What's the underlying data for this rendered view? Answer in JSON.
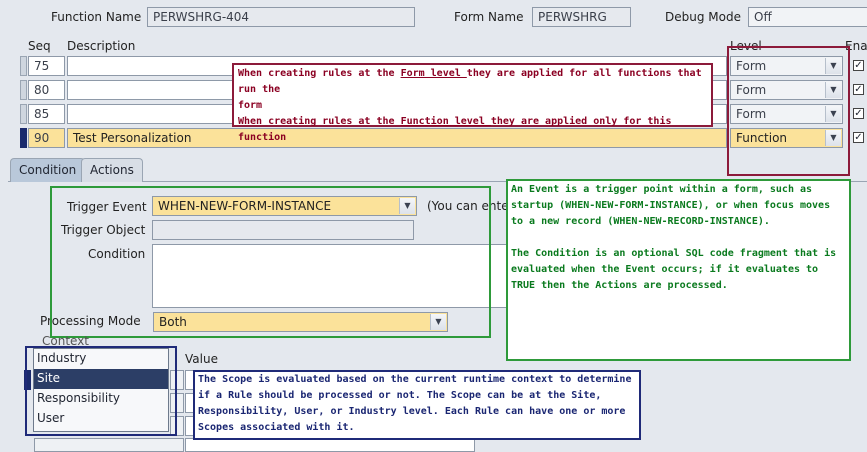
{
  "header": {
    "function_name_label": "Function Name",
    "function_name_value": "PERWSHRG-404",
    "form_name_label": "Form Name",
    "form_name_value": "PERWSHRG",
    "debug_mode_label": "Debug Mode",
    "debug_mode_value": "Off"
  },
  "grid": {
    "seq_header": "Seq",
    "description_header": "Description",
    "level_header": "Level",
    "enabled_header": "Ena",
    "rows": [
      {
        "seq": "75",
        "description": "",
        "level": "Form",
        "enabled": true
      },
      {
        "seq": "80",
        "description": "",
        "level": "Form",
        "enabled": true
      },
      {
        "seq": "85",
        "description": "",
        "level": "Form",
        "enabled": true
      },
      {
        "seq": "90",
        "description": "Test Personalization",
        "level": "Function",
        "enabled": true
      }
    ]
  },
  "annotations": {
    "level_note_line1_a": "When creating rules at the ",
    "level_note_line1_b": "Form level ",
    "level_note_line1_c": "they are applied for all functions that run the",
    "level_note_line2": "form",
    "level_note_line3_a": "When creating rules at the ",
    "level_note_line3_b": "Function level ",
    "level_note_line3_c": "they are applied only for this function",
    "event_note_p1": "An Event is a trigger point within a form, such as startup (WHEN-NEW-FORM-INSTANCE), or when focus moves to a new record (WHEN-NEW-RECORD-INSTANCE).",
    "event_note_p2": "The Condition is an optional SQL code fragment that is evaluated when the Event occurs; if it evaluates to TRUE then the Actions are processed.",
    "scope_note": "The Scope is evaluated based on the current runtime context to determine if a Rule should be processed or not. The Scope can be at the Site, Responsibility, User, or Industry level. Each Rule can have one or more Scopes associated with it."
  },
  "tabs": [
    {
      "label": "Condition",
      "active": true
    },
    {
      "label": "Actions",
      "active": false
    }
  ],
  "condition": {
    "trigger_event_label": "Trigger Event",
    "trigger_event_value": "WHEN-NEW-FORM-INSTANCE",
    "trigger_event_hint": "(You can ente",
    "trigger_object_label": "Trigger Object",
    "trigger_object_value": "",
    "condition_label": "Condition",
    "condition_value": "",
    "processing_mode_label": "Processing Mode",
    "processing_mode_value": "Both"
  },
  "context": {
    "label": "Context",
    "value_header": "Value",
    "options": [
      "Industry",
      "Site",
      "Responsibility",
      "User"
    ],
    "selected": "Site"
  },
  "colors": {
    "form_note_border": "#8c1a3a",
    "form_note_text": "#8b0022",
    "event_note_border": "#2e9a3a",
    "event_note_text": "#0a7a1e",
    "scope_note_border": "#1f2a78",
    "scope_note_text": "#1a2672",
    "selection_blue": "#2c3e66",
    "highlight_yellow": "#fbe29a"
  }
}
